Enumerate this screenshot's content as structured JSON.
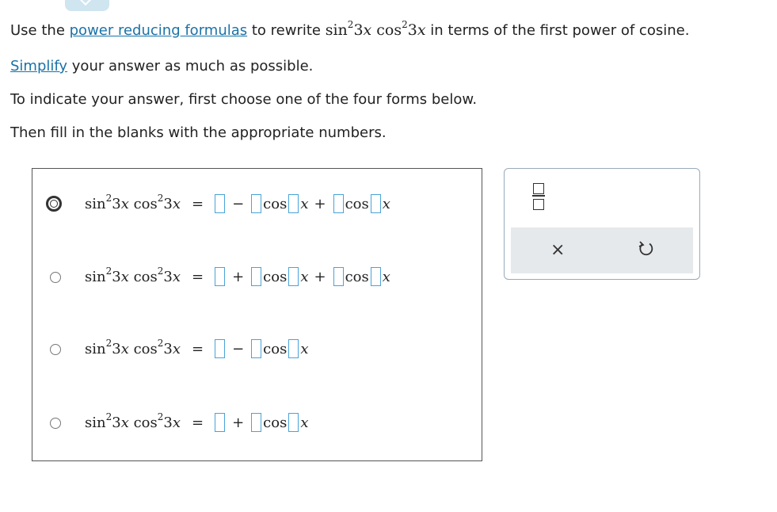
{
  "prompt": {
    "line1_before": "Use the ",
    "link_formula": "power reducing formulas",
    "line1_after_link": " to rewrite ",
    "math_expr": "sin²3x cos²3x",
    "line1_end": " in terms of the first power of cosine.",
    "link_simplify": "Simplify",
    "line2_end": " your answer as much as possible.",
    "line3": "To indicate your answer, first choose one of the four forms below.",
    "line4": "Then fill in the blanks with the appropriate numbers."
  },
  "options": [
    {
      "lhs": "sin²3x cos²3x",
      "selected": true,
      "ops": [
        "−",
        "+"
      ],
      "terms": 3
    },
    {
      "lhs": "sin²3x cos²3x",
      "selected": false,
      "ops": [
        "+",
        "+"
      ],
      "terms": 3
    },
    {
      "lhs": "sin²3x cos²3x",
      "selected": false,
      "ops": [
        "−"
      ],
      "terms": 2
    },
    {
      "lhs": "sin²3x cos²3x",
      "selected": false,
      "ops": [
        "+"
      ],
      "terms": 2
    }
  ],
  "cos_label": "cos",
  "var_x": "x",
  "equals": "=",
  "tools": {
    "fraction_icon": "fraction-icon",
    "clear_icon": "close-icon",
    "clear_symbol": "×",
    "undo_icon": "undo-icon"
  },
  "colors": {
    "link": "#1a72a6",
    "blank_border": "#4aa3d8",
    "toolbar_bg": "#e6e9ec"
  }
}
